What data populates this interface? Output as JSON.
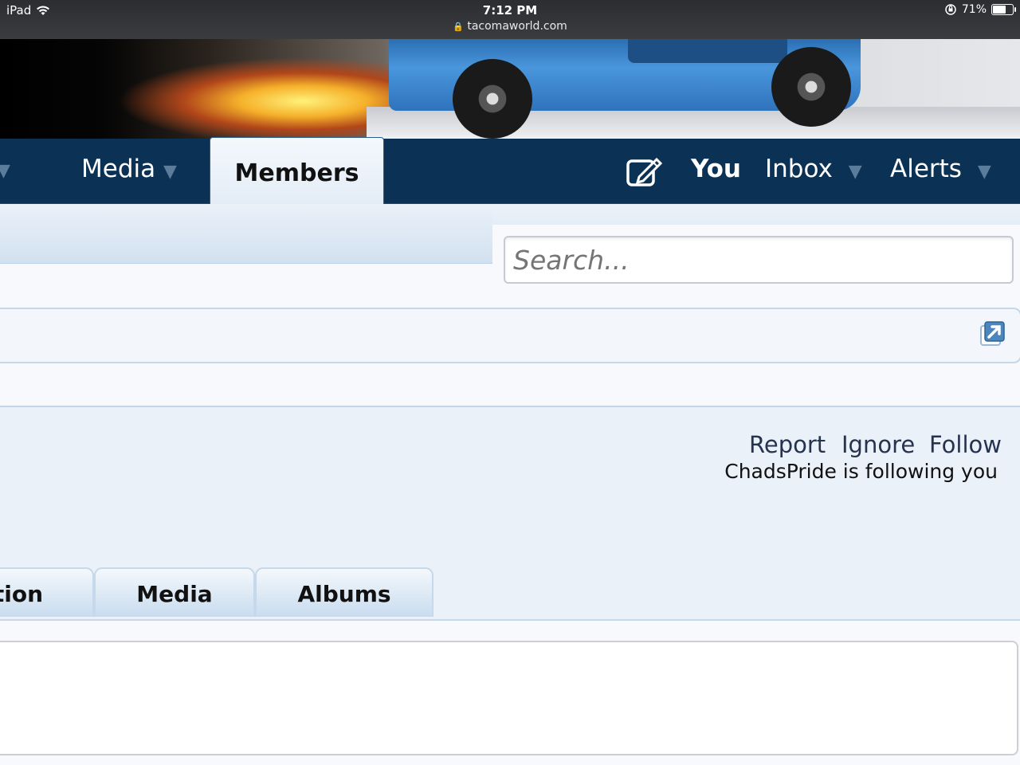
{
  "status_bar": {
    "device": "iPad",
    "time": "7:12 PM",
    "url": "tacomaworld.com",
    "battery": "71%",
    "battery_level": 0.71
  },
  "nav": {
    "left_arrow": "▼",
    "media_label": "Media",
    "members_label": "Members",
    "you_label": "You",
    "inbox_label": "Inbox",
    "alerts_label": "Alerts",
    "dropdown_glyph": "▼"
  },
  "search": {
    "placeholder": "Search..."
  },
  "profile": {
    "report_label": "Report",
    "ignore_label": "Ignore",
    "follow_label": "Follow",
    "following_text": "ChadsPride is following you"
  },
  "profile_tabs": [
    {
      "label": "tion"
    },
    {
      "label": "Media"
    },
    {
      "label": "Albums"
    }
  ],
  "colors": {
    "nav_bg": "#0b3254",
    "tab_bg": "#eaf1f9",
    "link": "#26334f"
  },
  "icons": {
    "compose": "compose-icon",
    "popup": "external-link-icon"
  }
}
